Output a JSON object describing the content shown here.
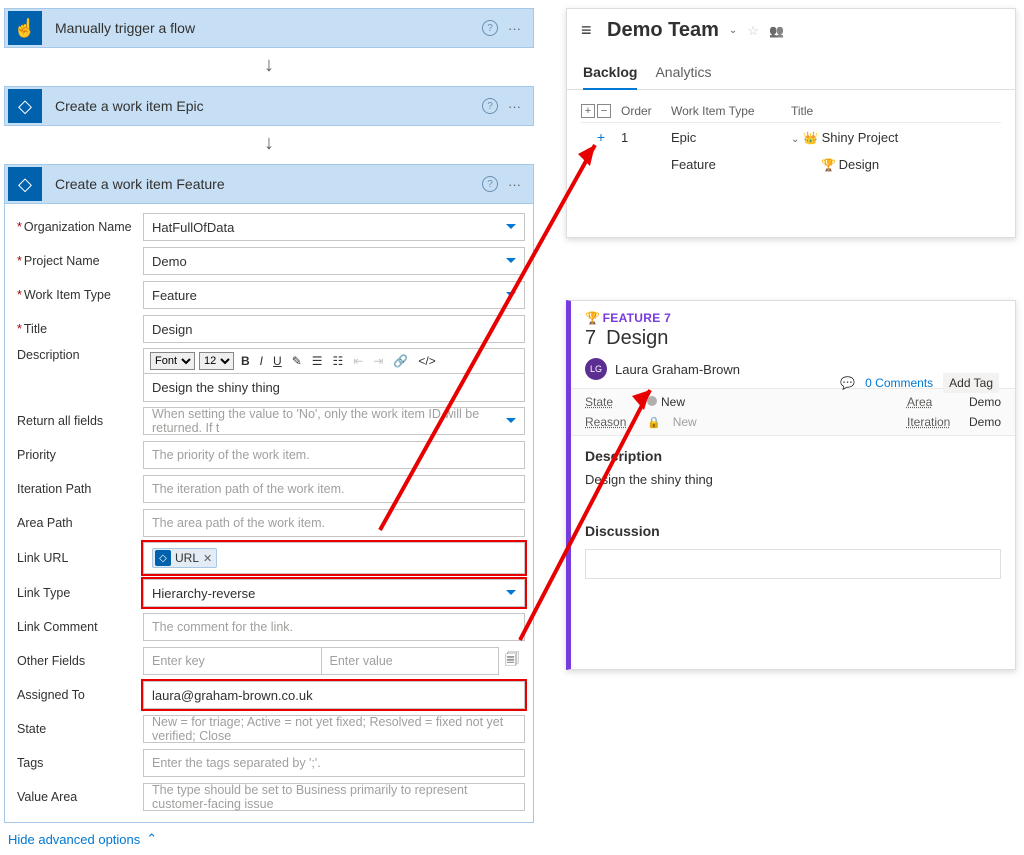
{
  "trigger": {
    "title": "Manually trigger a flow"
  },
  "epic_step": {
    "title": "Create a work item Epic"
  },
  "feature_step": {
    "title": "Create a work item Feature",
    "fields": {
      "org_label": "Organization Name",
      "org_value": "HatFullOfData",
      "proj_label": "Project Name",
      "proj_value": "Demo",
      "type_label": "Work Item Type",
      "type_value": "Feature",
      "title_label": "Title",
      "title_value": "Design",
      "desc_label": "Description",
      "desc_value": "Design the shiny thing",
      "return_label": "Return all fields",
      "return_ph": "When setting the value to 'No', only the work item ID will be returned. If t",
      "priority_label": "Priority",
      "priority_ph": "The priority of the work item.",
      "iter_label": "Iteration Path",
      "iter_ph": "The iteration path of the work item.",
      "area_label": "Area Path",
      "area_ph": "The area path of the work item.",
      "linkurl_label": "Link URL",
      "linkurl_token": "URL",
      "linktype_label": "Link Type",
      "linktype_value": "Hierarchy-reverse",
      "linkcomment_label": "Link Comment",
      "linkcomment_ph": "The comment for the link.",
      "otherfields_label": "Other Fields",
      "otherfields_key_ph": "Enter key",
      "otherfields_val_ph": "Enter value",
      "assigned_label": "Assigned To",
      "assigned_value": "laura@graham-brown.co.uk",
      "state_label": "State",
      "state_ph": "New = for triage; Active = not yet fixed; Resolved = fixed not yet verified; Close",
      "tags_label": "Tags",
      "tags_ph": "Enter the tags separated by ';'.",
      "valuearea_label": "Value Area",
      "valuearea_ph": "The type should be set to Business primarily to represent customer-facing issue"
    },
    "hide_link": "Hide advanced options",
    "rte": {
      "font_label": "Font",
      "size": "12"
    }
  },
  "boards": {
    "team_name": "Demo Team",
    "tabs": {
      "backlog": "Backlog",
      "analytics": "Analytics"
    },
    "cols": {
      "order": "Order",
      "type": "Work Item Type",
      "title": "Title"
    },
    "rows": [
      {
        "order": "1",
        "type": "Epic",
        "title": "Shiny Project"
      },
      {
        "order": "",
        "type": "Feature",
        "title": "Design"
      }
    ]
  },
  "workitem": {
    "banner": "FEATURE 7",
    "id": "7",
    "title": "Design",
    "person": "Laura Graham-Brown",
    "comments_count": "0 Comments",
    "add_tag": "Add Tag",
    "state_label": "State",
    "state_value": "New",
    "reason_label": "Reason",
    "reason_value": "New",
    "area_label": "Area",
    "area_value": "Demo",
    "iteration_label": "Iteration",
    "iteration_value": "Demo",
    "description_heading": "Description",
    "description_text": "Design the shiny thing",
    "discussion_heading": "Discussion"
  }
}
